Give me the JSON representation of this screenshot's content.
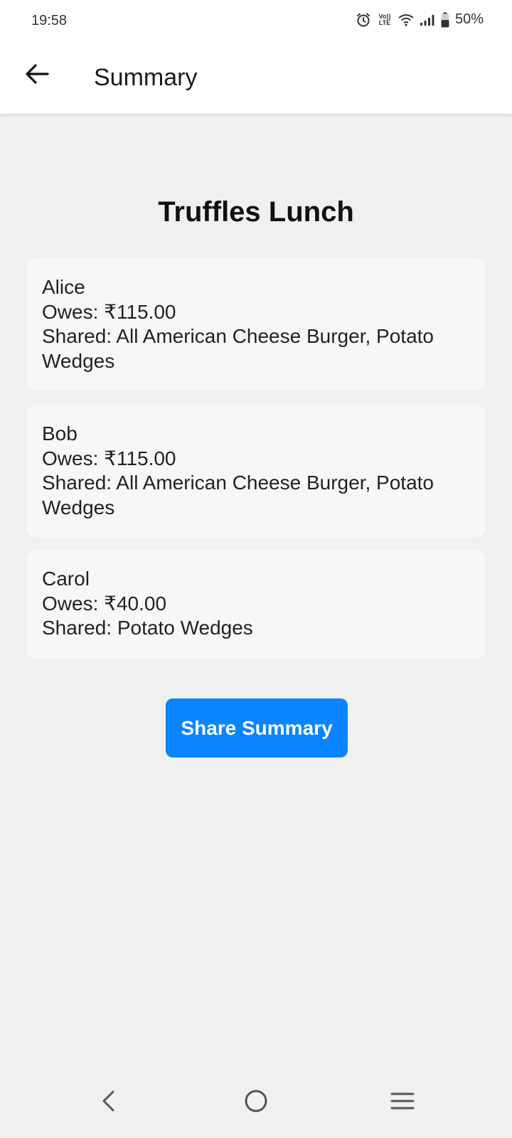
{
  "status_bar": {
    "time": "19:58",
    "volte_label": "Vo)) LTE",
    "battery": "50%"
  },
  "app_bar": {
    "title": "Summary"
  },
  "event": {
    "title": "Truffles Lunch"
  },
  "people": [
    {
      "name": "Alice",
      "owes": "Owes: ₹115.00",
      "shared": "Shared: All American Cheese Burger, Potato Wedges"
    },
    {
      "name": "Bob",
      "owes": "Owes: ₹115.00",
      "shared": "Shared: All American Cheese Burger, Potato Wedges"
    },
    {
      "name": "Carol",
      "owes": "Owes: ₹40.00",
      "shared": "Shared: Potato Wedges"
    }
  ],
  "actions": {
    "share_label": "Share Summary"
  },
  "colors": {
    "accent": "#0a84ff",
    "background": "#f0f0f0",
    "card": "#f7f7f7"
  },
  "icons": {
    "back": "arrow-left-icon",
    "nav_back": "chevron-left-icon",
    "nav_home": "circle-home-icon",
    "nav_recents": "menu-lines-icon"
  }
}
